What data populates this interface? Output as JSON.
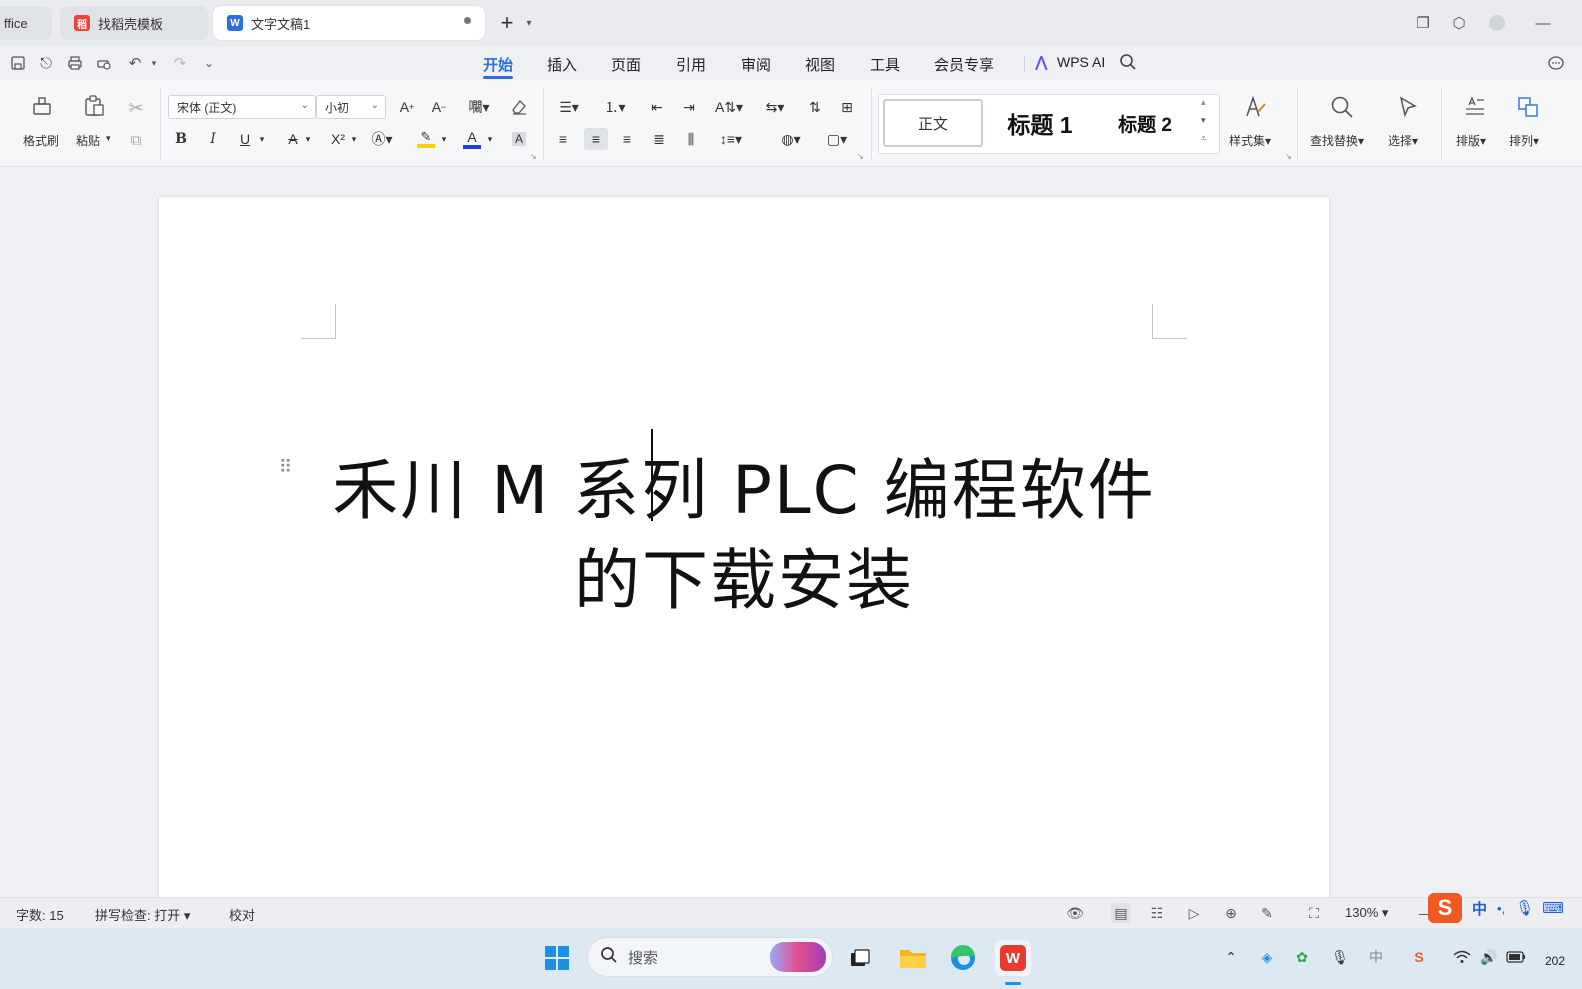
{
  "tabs": [
    {
      "label": "ffice",
      "active": false
    },
    {
      "label": "找稻壳模板",
      "active": false
    },
    {
      "label": "文字文稿1",
      "active": true
    }
  ],
  "tab_icon_letters": {
    "docer": "稻",
    "doc": "W"
  },
  "new_tab_symbol": "+",
  "menu": [
    "开始",
    "插入",
    "页面",
    "引用",
    "审阅",
    "视图",
    "工具",
    "会员专享",
    "WPS AI"
  ],
  "active_menu": "开始",
  "ribbon": {
    "format_painter": "格式刷",
    "paste": "粘贴",
    "font_name": "宋体 (正文)",
    "font_size": "小初",
    "styles": [
      "正文",
      "标题 1",
      "标题 2"
    ],
    "style_set": "样式集",
    "find_replace": "查找替换",
    "select": "选择",
    "layout": "排版",
    "arrange": "排列",
    "bold": "B",
    "italic": "I",
    "underline": "U",
    "strike": "A",
    "superscript": "X²",
    "font_color_letter": "A",
    "char_shade_letter": "A"
  },
  "document": {
    "title_line1": "禾川 M 系列 PLC 编程软件",
    "title_line2": "的下载安装"
  },
  "status": {
    "word_count": "字数: 15",
    "spell_check": "拼写检查: 打开",
    "proofread": "校对",
    "zoom": "130%"
  },
  "ime": {
    "lang": "中",
    "punct": "•,"
  },
  "taskbar": {
    "search_placeholder": "搜索",
    "clock": "202"
  },
  "colors": {
    "accent": "#2b6fdc",
    "highlight": "#f5d20a",
    "font_color": "#1f3fd1"
  }
}
